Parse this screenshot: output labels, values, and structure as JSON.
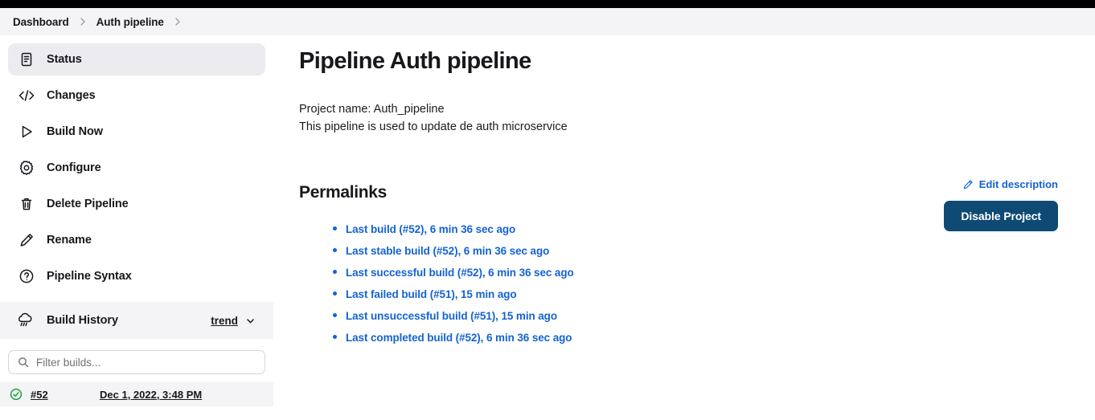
{
  "theme": {
    "link_blue": "#1463d2",
    "button_blue": "#0e4a73",
    "active_bg": "#ebebf0",
    "strip_bg": "#f4f4f6",
    "success_green": "#18a03a"
  },
  "breadcrumb": {
    "items": [
      {
        "label": "Dashboard"
      },
      {
        "label": "Auth pipeline"
      }
    ]
  },
  "sidebar": {
    "items": [
      {
        "label": "Status",
        "icon": "document-icon",
        "active": true
      },
      {
        "label": "Changes",
        "icon": "code-icon",
        "active": false
      },
      {
        "label": "Build Now",
        "icon": "play-icon",
        "active": false
      },
      {
        "label": "Configure",
        "icon": "gear-icon",
        "active": false
      },
      {
        "label": "Delete Pipeline",
        "icon": "trash-icon",
        "active": false
      },
      {
        "label": "Rename",
        "icon": "pencil-icon",
        "active": false
      },
      {
        "label": "Pipeline Syntax",
        "icon": "question-circle-icon",
        "active": false
      }
    ],
    "build_history": {
      "title": "Build History",
      "icon": "weather-cloud-rain-icon",
      "trend_label": "trend",
      "filter_placeholder": "Filter builds...",
      "filter_value": "",
      "builds": [
        {
          "status": "success",
          "number": "#52",
          "date": "Dec 1, 2022, 3:48 PM"
        }
      ]
    }
  },
  "main": {
    "title": "Pipeline Auth pipeline",
    "project_name_line": "Project name: Auth_pipeline",
    "description_line": "This pipeline is used to update de auth microservice",
    "edit_description_label": "Edit description",
    "disable_project_label": "Disable Project",
    "permalinks_title": "Permalinks",
    "permalinks": [
      {
        "label": "Last build (#52), 6 min 36 sec ago"
      },
      {
        "label": "Last stable build (#52), 6 min 36 sec ago"
      },
      {
        "label": "Last successful build (#52), 6 min 36 sec ago"
      },
      {
        "label": "Last failed build (#51), 15 min ago"
      },
      {
        "label": "Last unsuccessful build (#51), 15 min ago"
      },
      {
        "label": "Last completed build (#52), 6 min 36 sec ago"
      }
    ]
  }
}
